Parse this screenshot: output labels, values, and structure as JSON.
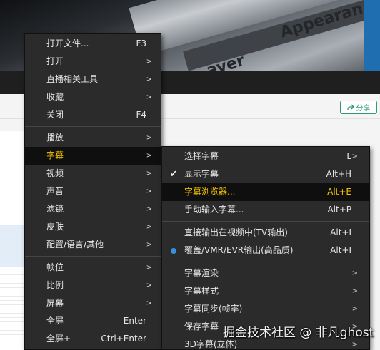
{
  "background": {
    "top_text": [
      "Appearan",
      "ayer"
    ],
    "share_button": {
      "label": "分享",
      "icon": "share-icon"
    }
  },
  "main_menu": {
    "items": [
      {
        "label": "打开文件...",
        "shortcut": "F3",
        "submenu": false
      },
      {
        "label": "打开",
        "shortcut": "",
        "submenu": true
      },
      {
        "label": "直播相关工具",
        "shortcut": "",
        "submenu": true
      },
      {
        "label": "收藏",
        "shortcut": "",
        "submenu": true
      },
      {
        "label": "关闭",
        "shortcut": "F4",
        "submenu": false
      },
      {
        "label": "播放",
        "shortcut": "",
        "submenu": true
      },
      {
        "label": "字幕",
        "shortcut": "",
        "submenu": true,
        "active": true
      },
      {
        "label": "视频",
        "shortcut": "",
        "submenu": true
      },
      {
        "label": "声音",
        "shortcut": "",
        "submenu": true
      },
      {
        "label": "滤镜",
        "shortcut": "",
        "submenu": true
      },
      {
        "label": "皮肤",
        "shortcut": "",
        "submenu": true
      },
      {
        "label": "配置/语言/其他",
        "shortcut": "",
        "submenu": true
      },
      {
        "label": "帧位",
        "shortcut": "",
        "submenu": true
      },
      {
        "label": "比例",
        "shortcut": "",
        "submenu": true
      },
      {
        "label": "屏幕",
        "shortcut": "",
        "submenu": true
      },
      {
        "label": "全屏",
        "shortcut": "Enter",
        "submenu": false
      },
      {
        "label": "全屏+",
        "shortcut": "Ctrl+Enter",
        "submenu": false
      }
    ]
  },
  "subtitle_menu": {
    "items": [
      {
        "label": "选择字幕",
        "shortcut": "L",
        "submenu": true,
        "mark": ""
      },
      {
        "label": "显示字幕",
        "shortcut": "Alt+H",
        "submenu": false,
        "mark": "check"
      },
      {
        "label": "字幕浏览器...",
        "shortcut": "Alt+E",
        "submenu": false,
        "mark": "",
        "active": true
      },
      {
        "label": "手动输入字幕...",
        "shortcut": "Alt+P",
        "submenu": false,
        "mark": ""
      },
      {
        "label": "直接输出在视频中(TV输出)",
        "shortcut": "Alt+I",
        "submenu": false,
        "mark": ""
      },
      {
        "label": "覆盖/VMR/EVR输出(高品质)",
        "shortcut": "Alt+I",
        "submenu": false,
        "mark": "radio"
      },
      {
        "label": "字幕渲染",
        "shortcut": "",
        "submenu": true,
        "mark": ""
      },
      {
        "label": "字幕样式",
        "shortcut": "",
        "submenu": true,
        "mark": ""
      },
      {
        "label": "字幕同步(帧率)",
        "shortcut": "",
        "submenu": true,
        "mark": ""
      },
      {
        "label": "保存字幕",
        "shortcut": "",
        "submenu": true,
        "mark": ""
      },
      {
        "label": "3D字幕(立体)",
        "shortcut": "",
        "submenu": true,
        "mark": ""
      }
    ]
  },
  "watermark": "掘金技术社区 @ 非凡ghost",
  "colors": {
    "highlight_text": "#f2c200",
    "radio_dot": "#3a8fe0",
    "share_green": "#2e9b74"
  }
}
